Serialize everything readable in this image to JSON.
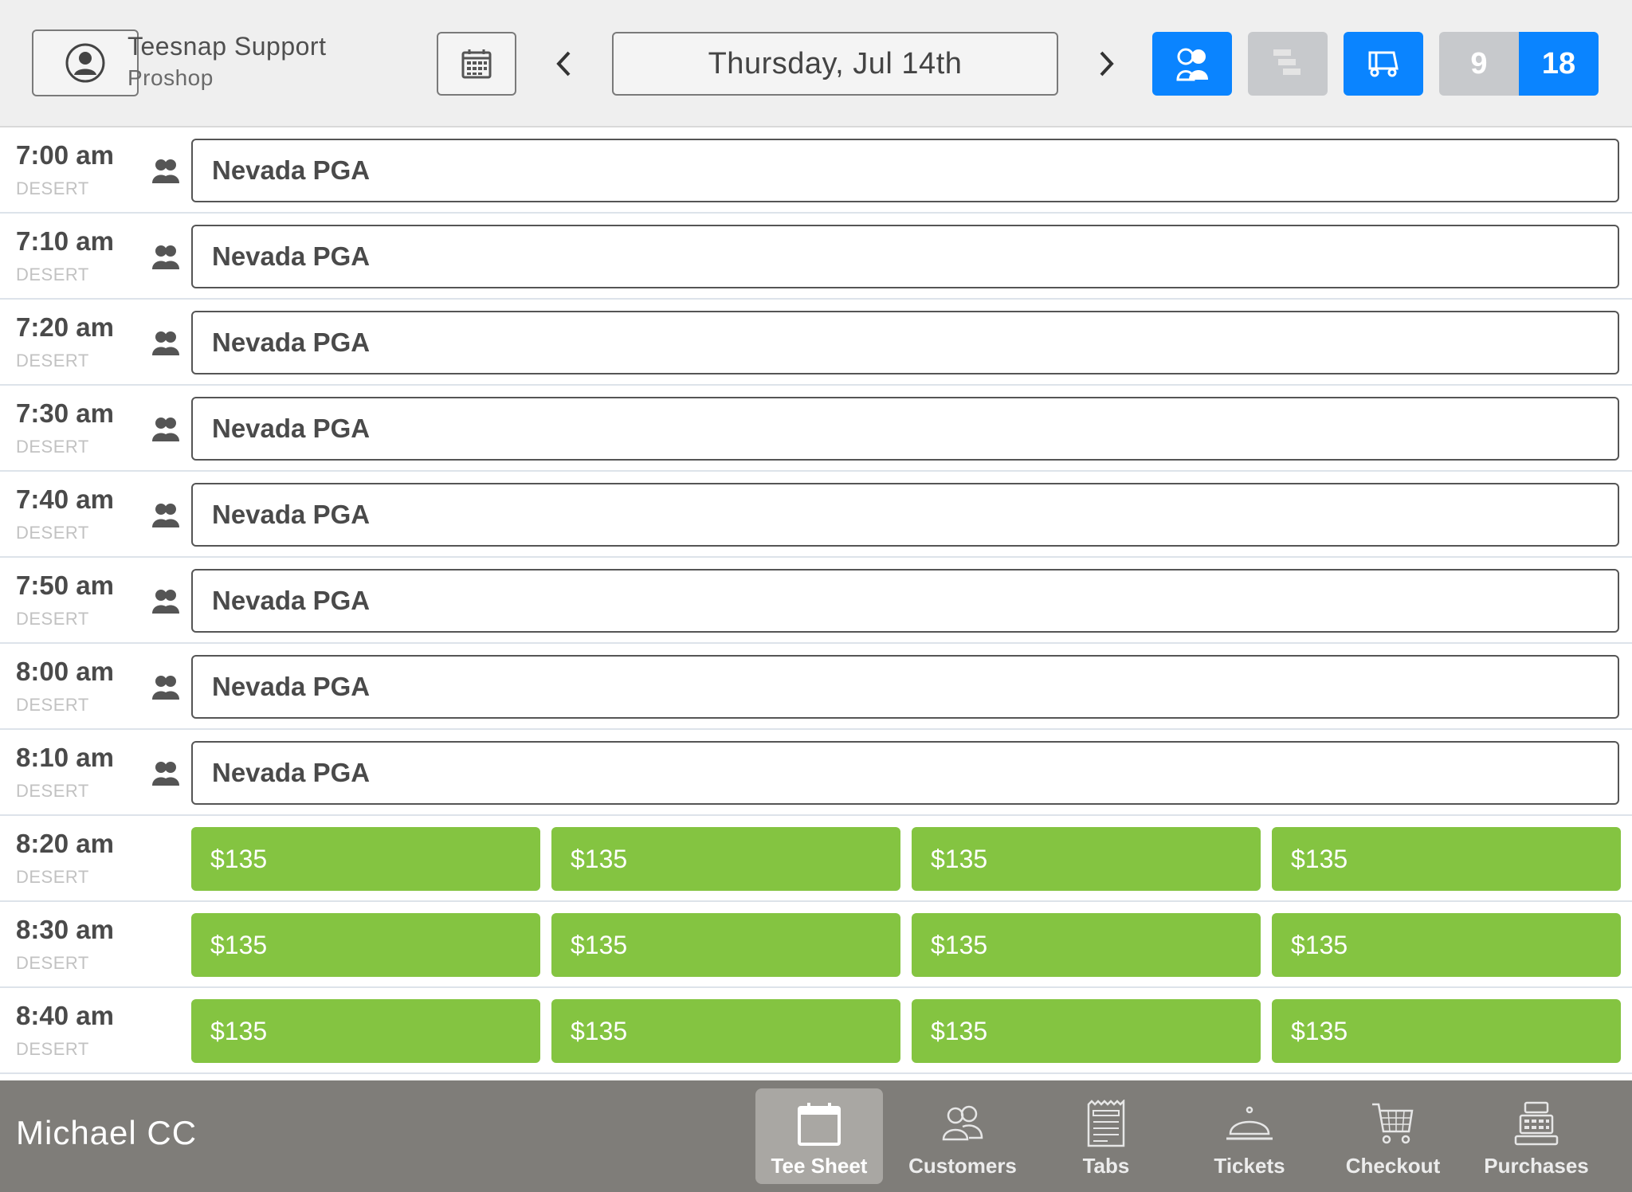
{
  "header": {
    "user_name": "Teesnap Support",
    "user_role": "Proshop",
    "date": "Thursday, Jul 14th",
    "holes_options": [
      "9",
      "18"
    ],
    "selected_holes": "18"
  },
  "colors": {
    "accent": "#0a84ff",
    "available_slot": "#84c441",
    "footer": "#7f7d79"
  },
  "rows": [
    {
      "time": "7:00 am",
      "course": "DESERT",
      "event": "Nevada PGA"
    },
    {
      "time": "7:10 am",
      "course": "DESERT",
      "event": "Nevada PGA"
    },
    {
      "time": "7:20 am",
      "course": "DESERT",
      "event": "Nevada PGA"
    },
    {
      "time": "7:30 am",
      "course": "DESERT",
      "event": "Nevada PGA"
    },
    {
      "time": "7:40 am",
      "course": "DESERT",
      "event": "Nevada PGA"
    },
    {
      "time": "7:50 am",
      "course": "DESERT",
      "event": "Nevada PGA"
    },
    {
      "time": "8:00 am",
      "course": "DESERT",
      "event": "Nevada PGA"
    },
    {
      "time": "8:10 am",
      "course": "DESERT",
      "event": "Nevada PGA"
    },
    {
      "time": "8:20 am",
      "course": "DESERT",
      "slots": [
        "$135",
        "$135",
        "$135",
        "$135"
      ]
    },
    {
      "time": "8:30 am",
      "course": "DESERT",
      "slots": [
        "$135",
        "$135",
        "$135",
        "$135"
      ]
    },
    {
      "time": "8:40 am",
      "course": "DESERT",
      "slots": [
        "$135",
        "$135",
        "$135",
        "$135"
      ]
    }
  ],
  "footer": {
    "facility": "Michael CC",
    "tabs": [
      {
        "label": "Tee Sheet",
        "icon": "calendar-icon",
        "active": true
      },
      {
        "label": "Customers",
        "icon": "people-icon",
        "active": false
      },
      {
        "label": "Tabs",
        "icon": "receipt-icon",
        "active": false
      },
      {
        "label": "Tickets",
        "icon": "service-bell-icon",
        "active": false
      },
      {
        "label": "Checkout",
        "icon": "cart-icon",
        "active": false
      },
      {
        "label": "Purchases",
        "icon": "register-icon",
        "active": false
      }
    ]
  }
}
